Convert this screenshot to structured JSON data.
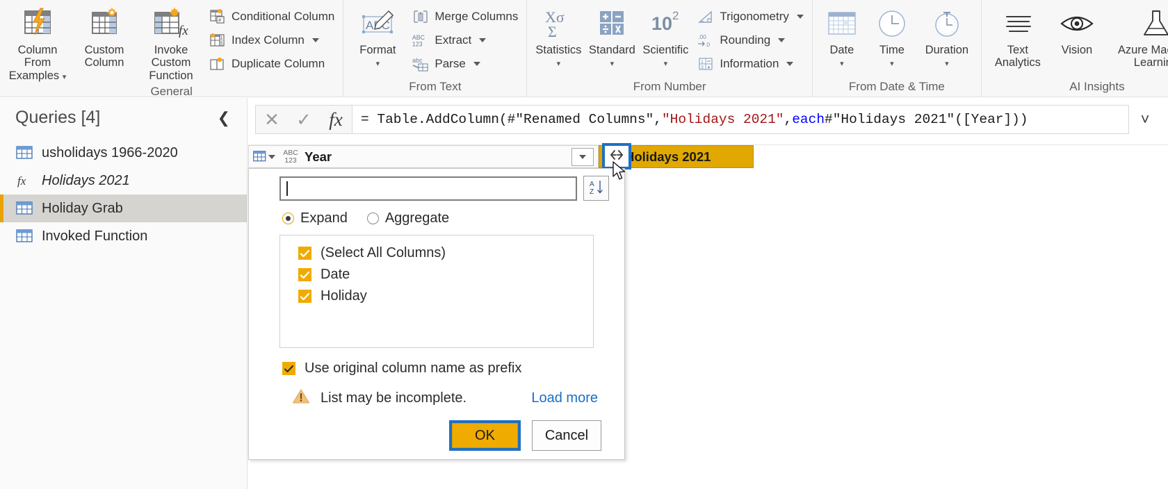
{
  "ribbon": {
    "groups": [
      {
        "title": "General",
        "big_buttons": [
          {
            "label_line1": "Column From",
            "label_line2": "Examples",
            "has_caret": true,
            "icon": "table-lightning-icon"
          },
          {
            "label_line1": "Custom",
            "label_line2": "Column",
            "has_caret": false,
            "icon": "table-star-icon"
          },
          {
            "label_line1": "Invoke Custom",
            "label_line2": "Function",
            "has_caret": false,
            "icon": "table-fx-icon"
          }
        ],
        "small_buttons": [
          {
            "label": "Conditional Column",
            "has_caret": false,
            "icon": "conditional-column-icon"
          },
          {
            "label": "Index Column",
            "has_caret": true,
            "icon": "index-column-icon"
          },
          {
            "label": "Duplicate Column",
            "has_caret": false,
            "icon": "duplicate-column-icon"
          }
        ]
      },
      {
        "title": "From Text",
        "big_buttons": [
          {
            "label_line1": "Format",
            "label_line2": "",
            "has_caret": true,
            "icon": "abc-pencil-icon"
          }
        ],
        "small_buttons": [
          {
            "label": "Merge Columns",
            "has_caret": false,
            "icon": "merge-columns-icon"
          },
          {
            "label": "Extract",
            "has_caret": true,
            "icon": "abc123-icon"
          },
          {
            "label": "Parse",
            "has_caret": true,
            "icon": "parse-icon"
          }
        ]
      },
      {
        "title": "From Number",
        "big_buttons": [
          {
            "label_line1": "Statistics",
            "label_line2": "",
            "has_caret": true,
            "icon": "sigma-icon"
          },
          {
            "label_line1": "Standard",
            "label_line2": "",
            "has_caret": true,
            "icon": "operators-icon"
          },
          {
            "label_line1": "Scientific",
            "label_line2": "",
            "has_caret": true,
            "icon": "power-ten-icon"
          }
        ],
        "small_buttons": [
          {
            "label": "Trigonometry",
            "has_caret": true,
            "icon": "trigonometry-icon"
          },
          {
            "label": "Rounding",
            "has_caret": true,
            "icon": "rounding-icon"
          },
          {
            "label": "Information",
            "has_caret": true,
            "icon": "information-icon"
          }
        ]
      },
      {
        "title": "From Date & Time",
        "big_buttons": [
          {
            "label_line1": "Date",
            "label_line2": "",
            "has_caret": true,
            "icon": "calendar-icon"
          },
          {
            "label_line1": "Time",
            "label_line2": "",
            "has_caret": true,
            "icon": "clock-icon"
          },
          {
            "label_line1": "Duration",
            "label_line2": "",
            "has_caret": true,
            "icon": "stopwatch-icon"
          }
        ],
        "small_buttons": []
      },
      {
        "title": "AI Insights",
        "big_buttons": [
          {
            "label_line1": "Text",
            "label_line2": "Analytics",
            "has_caret": false,
            "icon": "text-lines-icon"
          },
          {
            "label_line1": "Vision",
            "label_line2": "",
            "has_caret": false,
            "icon": "eye-icon"
          },
          {
            "label_line1": "Azure Machine",
            "label_line2": "Learning",
            "has_caret": false,
            "icon": "flask-icon"
          }
        ],
        "small_buttons": []
      }
    ]
  },
  "queries_pane": {
    "title": "Queries [4]",
    "collapse_icon": "chevron-left-icon",
    "items": [
      {
        "label": "usholidays 1966-2020",
        "icon": "table-icon",
        "selected": false,
        "italic": false
      },
      {
        "label": "Holidays 2021",
        "icon": "fx-icon",
        "selected": false,
        "italic": true
      },
      {
        "label": "Holiday Grab",
        "icon": "table-icon",
        "selected": true,
        "italic": false
      },
      {
        "label": "Invoked Function",
        "icon": "table-icon",
        "selected": false,
        "italic": false
      }
    ]
  },
  "formula_bar": {
    "cancel_icon": "x-icon",
    "accept_icon": "check-icon",
    "fx_icon": "fx-icon",
    "expand_icon": "chevron-down-icon",
    "formula_segments": [
      {
        "text": "= Table.AddColumn(#\"Renamed Columns\", ",
        "kind": "plain"
      },
      {
        "text": "\"Holidays 2021\"",
        "kind": "string"
      },
      {
        "text": ", ",
        "kind": "plain"
      },
      {
        "text": "each",
        "kind": "keyword"
      },
      {
        "text": " #\"Holidays 2021\"([Year]))",
        "kind": "plain"
      }
    ]
  },
  "table_header": {
    "corner_icon": "table-select-icon",
    "columns": [
      {
        "name": "Year",
        "type_icon": "ABC123",
        "highlighted": false,
        "has_filter_button": true
      },
      {
        "name": "Holidays 2021",
        "type_icon": "ABC123",
        "highlighted": true,
        "has_filter_button": false
      }
    ],
    "expand_button": {
      "icon": "expand-columns-icon",
      "highlighted": true
    }
  },
  "expand_panel": {
    "search_value": "",
    "search_placeholder": "",
    "sort_button_icon": "sort-az-icon",
    "mode_options": [
      {
        "label": "Expand",
        "selected": true
      },
      {
        "label": "Aggregate",
        "selected": false
      }
    ],
    "columns": [
      {
        "label": "(Select All Columns)",
        "checked": true
      },
      {
        "label": "Date",
        "checked": true
      },
      {
        "label": "Holiday",
        "checked": true
      }
    ],
    "prefix_option": {
      "label": "Use original column name as prefix",
      "checked": true
    },
    "warning": {
      "icon": "warning-triangle-icon",
      "text": "List may be incomplete.",
      "link_label": "Load more"
    },
    "buttons": {
      "ok_label": "OK",
      "ok_highlighted": true,
      "cancel_label": "Cancel"
    }
  },
  "colors": {
    "accent_amber": "#f0ab00",
    "header_highlight": "#e0a800",
    "focus_blue": "#1f6fc4",
    "link_blue": "#1a6fc4",
    "selected_row": "#d6d4d1"
  },
  "cursor": {
    "icon": "mouse-pointer-icon"
  }
}
